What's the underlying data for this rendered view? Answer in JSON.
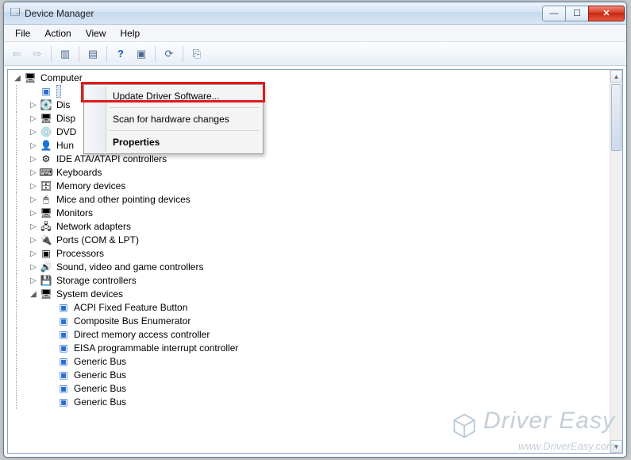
{
  "window": {
    "title": "Device Manager"
  },
  "menu": {
    "file": "File",
    "action": "Action",
    "view": "View",
    "help": "Help"
  },
  "toolbar": {
    "back_icon": "⇦",
    "fwd_icon": "⇨",
    "t1": "▥",
    "t2": "▤",
    "t3": "?",
    "t4": "▣",
    "t5": "⟳",
    "t6": "⎘"
  },
  "tree": {
    "root": "Computer",
    "root_child_prefix": "Dis",
    "nodes": [
      "Disp",
      "DVD",
      "Hun",
      "IDE ATA/ATAPI controllers",
      "Keyboards",
      "Memory devices",
      "Mice and other pointing devices",
      "Monitors",
      "Network adapters",
      "Ports (COM & LPT)",
      "Processors",
      "Sound, video and game controllers",
      "Storage controllers",
      "System devices"
    ],
    "sysdev": [
      "ACPI Fixed Feature Button",
      "Composite Bus Enumerator",
      "Direct memory access controller",
      "EISA programmable interrupt controller",
      "Generic Bus",
      "Generic Bus",
      "Generic Bus",
      "Generic Bus"
    ],
    "icons": {
      "Disp": "🖥",
      "DVD": "💿",
      "Hun": "👤",
      "IDE ATA/ATAPI controllers": "⚙",
      "Keyboards": "⌨",
      "Memory devices": "🗄",
      "Mice and other pointing devices": "🖱",
      "Monitors": "🖥",
      "Network adapters": "🖧",
      "Ports (COM & LPT)": "🔌",
      "Processors": "▣",
      "Sound, video and game controllers": "🔊",
      "Storage controllers": "💾",
      "System devices": "🖥"
    }
  },
  "context_menu": {
    "update": "Update Driver Software...",
    "scan": "Scan for hardware changes",
    "properties": "Properties"
  },
  "watermark": {
    "brand": "Driver Easy",
    "url": "www.DriverEasy.com"
  }
}
